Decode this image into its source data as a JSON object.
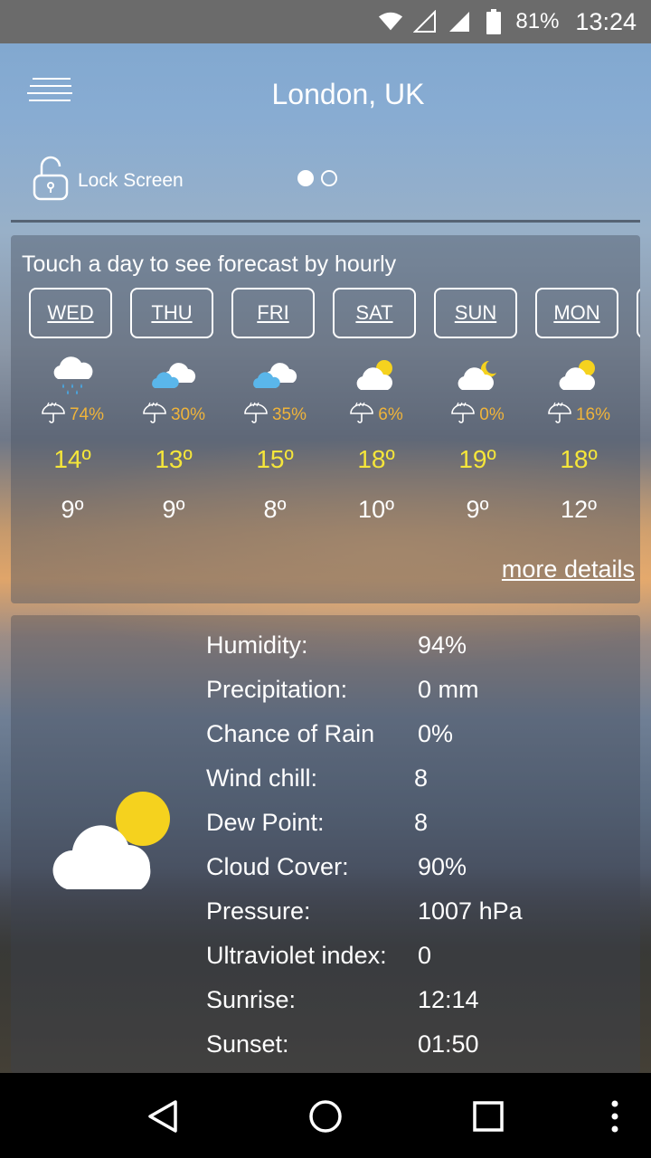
{
  "status": {
    "battery": "81%",
    "time": "13:24"
  },
  "header": {
    "city": "London, UK",
    "lock_label": "Lock Screen"
  },
  "forecast": {
    "hint": "Touch a day to see forecast by hourly",
    "more": "more details",
    "days": [
      {
        "day": "WED",
        "icon": "rain-cloud-icon",
        "rain": "74%",
        "hi": "14º",
        "lo": "9º"
      },
      {
        "day": "THU",
        "icon": "cloud-icon",
        "rain": "30%",
        "hi": "13º",
        "lo": "9º"
      },
      {
        "day": "FRI",
        "icon": "cloud-icon",
        "rain": "35%",
        "hi": "15º",
        "lo": "8º"
      },
      {
        "day": "SAT",
        "icon": "partly-sunny-icon",
        "rain": "6%",
        "hi": "18º",
        "lo": "10º"
      },
      {
        "day": "SUN",
        "icon": "partly-cloudy-night-icon",
        "rain": "0%",
        "hi": "19º",
        "lo": "9º"
      },
      {
        "day": "MON",
        "icon": "partly-sunny-icon",
        "rain": "16%",
        "hi": "18º",
        "lo": "12º"
      }
    ]
  },
  "details": [
    {
      "k": "Humidity:",
      "v": "94%"
    },
    {
      "k": "Precipitation:",
      "v": "0 mm"
    },
    {
      "k": "Chance of Rain",
      "v": "0%"
    },
    {
      "k": "Wind chill:",
      "v": "8"
    },
    {
      "k": "Dew Point:",
      "v": "8"
    },
    {
      "k": "Cloud Cover:",
      "v": "90%"
    },
    {
      "k": "Pressure:",
      "v": "1007 hPa"
    },
    {
      "k": "Ultraviolet index:",
      "v": "0"
    },
    {
      "k": "Sunrise:",
      "v": "12:14"
    },
    {
      "k": "Sunset:",
      "v": "01:50"
    }
  ]
}
